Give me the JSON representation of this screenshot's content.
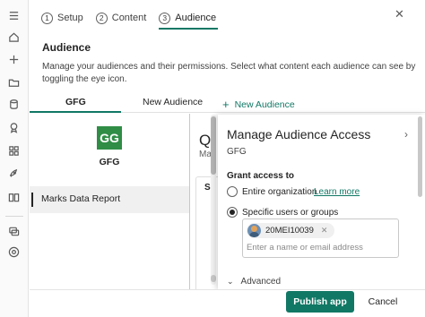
{
  "rail": {
    "icons": [
      "menu-icon",
      "home-icon",
      "create-icon",
      "folder-icon",
      "database-icon",
      "goals-icon",
      "apps-icon",
      "deploy-icon",
      "learn-icon",
      "workspaces-icon",
      "onelake-icon"
    ]
  },
  "steps": [
    {
      "num": "1",
      "label": "Setup"
    },
    {
      "num": "2",
      "label": "Content"
    },
    {
      "num": "3",
      "label": "Audience"
    }
  ],
  "header": {
    "title": "Audience",
    "description": "Manage your audiences and their permissions. Select what content each audience can see by toggling the eye icon."
  },
  "tabs": {
    "gfg": "GFG",
    "new_audience": "New Audience",
    "add_new_audience": "New Audience"
  },
  "audience": {
    "logo_text": "GG",
    "name": "GFG",
    "report": "Marks Data Report"
  },
  "preview": {
    "title": "Q",
    "subtitle": "Ma",
    "card_title": "S"
  },
  "panel": {
    "title": "Manage Audience Access",
    "subtitle": "GFG",
    "grant_heading": "Grant access to",
    "option_org": "Entire organization",
    "learn_more": "Learn more",
    "option_specific": "Specific users or groups",
    "selected": "specific",
    "chip_user": "20MEI10039",
    "input_placeholder": "Enter a name or email address",
    "advanced": "Advanced"
  },
  "footer": {
    "publish": "Publish app",
    "cancel": "Cancel"
  },
  "colors": {
    "accent": "#117865",
    "logo_bg": "#2f8d46"
  }
}
